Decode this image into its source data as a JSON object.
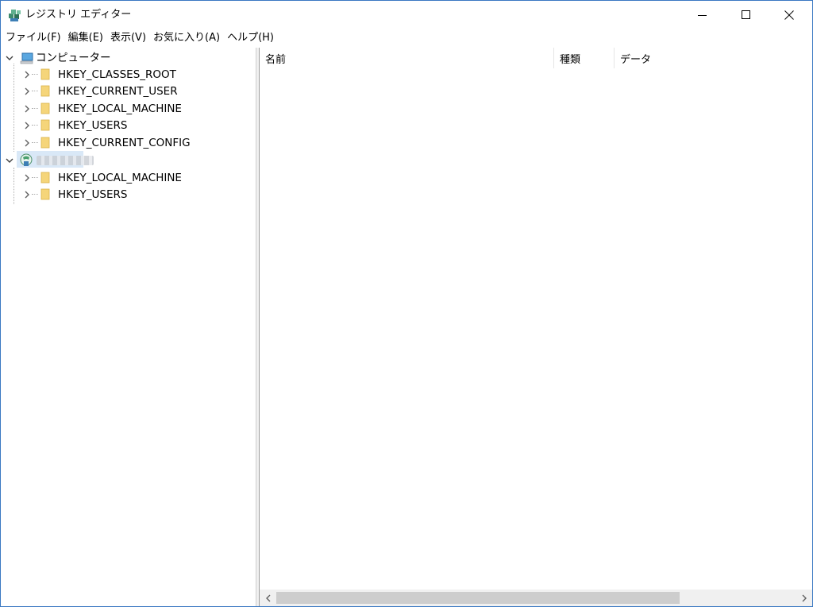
{
  "window": {
    "title": "レジストリ エディター"
  },
  "menu": {
    "items": [
      "ファイル(F)",
      "編集(E)",
      "表示(V)",
      "お気に入り(A)",
      "ヘルプ(H)"
    ]
  },
  "tree": {
    "computer_label": "コンピューター",
    "local_hives": [
      "HKEY_CLASSES_ROOT",
      "HKEY_CURRENT_USER",
      "HKEY_LOCAL_MACHINE",
      "HKEY_USERS",
      "HKEY_CURRENT_CONFIG"
    ],
    "remote_label": "",
    "remote_hives": [
      "HKEY_LOCAL_MACHINE",
      "HKEY_USERS"
    ]
  },
  "list": {
    "columns": [
      "名前",
      "種類",
      "データ"
    ]
  },
  "colors": {
    "window_border": "#3a78c2",
    "folder": "#f5d57a",
    "selection": "#d9e8f7",
    "scroll_thumb": "#cdcdcd"
  },
  "icons": {
    "app": "registry-editor-icon",
    "computer": "computer-icon",
    "remote": "network-computer-icon",
    "folder": "folder-icon"
  }
}
